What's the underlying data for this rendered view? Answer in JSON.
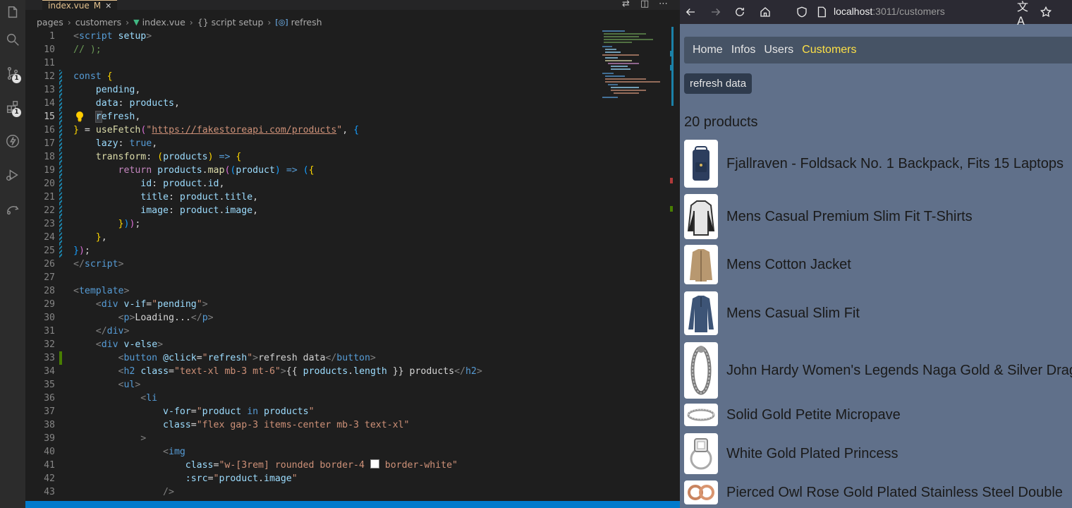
{
  "vscode": {
    "tab": {
      "filename": "index.vue",
      "modified": "M"
    },
    "breadcrumb": [
      "pages",
      "customers",
      "index.vue",
      "{} script setup",
      "refresh"
    ],
    "lines": [
      {
        "n": "1",
        "html": "<span class='pun'>&lt;</span><span class='tag'>script</span> <span class='attr'>setup</span><span class='pun'>&gt;</span>"
      },
      {
        "n": "10",
        "html": "<span class='cmt'>// );</span>"
      },
      {
        "n": "11",
        "html": ""
      },
      {
        "n": "12",
        "html": "<span class='kw'>const</span> <span class='br1'>{</span>"
      },
      {
        "n": "13",
        "html": "    <span class='var'>pending</span><span class='plain'>,</span>"
      },
      {
        "n": "14",
        "html": "    <span class='var'>data</span><span class='plain'>:</span> <span class='var'>products</span><span class='plain'>,</span>"
      },
      {
        "n": "15",
        "html": "    <span class='var hl'>r</span><span class='var'>efresh</span><span class='plain'>,</span>"
      },
      {
        "n": "16",
        "html": "<span class='br1'>}</span> <span class='plain'>=</span> <span class='fn'>useFetch</span><span class='br2'>(</span><span class='str'>\"</span><span class='url'>https://fakestoreapi.com/products</span><span class='str'>\"</span><span class='plain'>,</span> <span class='br3'>{</span>"
      },
      {
        "n": "17",
        "html": "    <span class='var'>lazy</span><span class='plain'>:</span> <span class='kw'>true</span><span class='plain'>,</span>"
      },
      {
        "n": "18",
        "html": "    <span class='fn'>transform</span><span class='plain'>:</span> <span class='br1'>(</span><span class='var'>products</span><span class='br1'>)</span> <span class='kw'>=&gt;</span> <span class='br1'>{</span>"
      },
      {
        "n": "19",
        "html": "        <span class='ctl'>return</span> <span class='var'>products</span><span class='plain'>.</span><span class='fn'>map</span><span class='br2'>(</span><span class='br3'>(</span><span class='var'>product</span><span class='br3'>)</span> <span class='kw'>=&gt;</span> <span class='br3'>(</span><span class='br1'>{</span>"
      },
      {
        "n": "20",
        "html": "            <span class='var'>id</span><span class='plain'>:</span> <span class='var'>product</span><span class='plain'>.</span><span class='var'>id</span><span class='plain'>,</span>"
      },
      {
        "n": "21",
        "html": "            <span class='var'>title</span><span class='plain'>:</span> <span class='var'>product</span><span class='plain'>.</span><span class='var'>title</span><span class='plain'>,</span>"
      },
      {
        "n": "22",
        "html": "            <span class='var'>image</span><span class='plain'>:</span> <span class='var'>product</span><span class='plain'>.</span><span class='var'>image</span><span class='plain'>,</span>"
      },
      {
        "n": "23",
        "html": "        <span class='br1'>}</span><span class='br3'>)</span><span class='br2'>)</span><span class='plain'>;</span>"
      },
      {
        "n": "24",
        "html": "    <span class='br1'>}</span><span class='plain'>,</span>"
      },
      {
        "n": "25",
        "html": "<span class='br3'>}</span><span class='br2'>)</span><span class='plain'>;</span>"
      },
      {
        "n": "26",
        "html": "<span class='pun'>&lt;/</span><span class='tag'>script</span><span class='pun'>&gt;</span>"
      },
      {
        "n": "27",
        "html": ""
      },
      {
        "n": "28",
        "html": "<span class='pun'>&lt;</span><span class='tag'>template</span><span class='pun'>&gt;</span>"
      },
      {
        "n": "29",
        "html": "    <span class='pun'>&lt;</span><span class='tag'>div</span> <span class='attr'>v-if</span><span class='plain'>=</span><span class='str'>\"</span><span class='var'>pending</span><span class='str'>\"</span><span class='pun'>&gt;</span>"
      },
      {
        "n": "30",
        "html": "        <span class='pun'>&lt;</span><span class='tag'>p</span><span class='pun'>&gt;</span><span class='plain'>Loading...</span><span class='pun'>&lt;/</span><span class='tag'>p</span><span class='pun'>&gt;</span>"
      },
      {
        "n": "31",
        "html": "    <span class='pun'>&lt;/</span><span class='tag'>div</span><span class='pun'>&gt;</span>"
      },
      {
        "n": "32",
        "html": "    <span class='pun'>&lt;</span><span class='tag'>div</span> <span class='attr'>v-else</span><span class='pun'>&gt;</span>"
      },
      {
        "n": "33",
        "html": "        <span class='pun'>&lt;</span><span class='tag'>button</span> <span class='attr'>@click</span><span class='plain'>=</span><span class='str'>\"</span><span class='var'>refresh</span><span class='str'>\"</span><span class='pun'>&gt;</span><span class='plain'>refresh data</span><span class='pun'>&lt;/</span><span class='tag'>button</span><span class='pun'>&gt;</span>"
      },
      {
        "n": "34",
        "html": "        <span class='pun'>&lt;</span><span class='tag'>h2</span> <span class='attr'>class</span><span class='plain'>=</span><span class='str'>\"text-xl mb-3 mt-6\"</span><span class='pun'>&gt;</span><span class='plain'>{{</span> <span class='var'>products</span><span class='plain'>.</span><span class='var'>length</span> <span class='plain'>}} products</span><span class='pun'>&lt;/</span><span class='tag'>h2</span><span class='pun'>&gt;</span>"
      },
      {
        "n": "35",
        "html": "        <span class='pun'>&lt;</span><span class='tag'>ul</span><span class='pun'>&gt;</span>"
      },
      {
        "n": "36",
        "html": "            <span class='pun'>&lt;</span><span class='tag'>li</span>"
      },
      {
        "n": "37",
        "html": "                <span class='attr'>v-for</span><span class='plain'>=</span><span class='str'>\"</span><span class='var'>product</span> <span class='kw'>in</span> <span class='var'>products</span><span class='str'>\"</span>"
      },
      {
        "n": "38",
        "html": "                <span class='attr'>class</span><span class='plain'>=</span><span class='str'>\"flex gap-3 items-center mb-3 text-xl\"</span>"
      },
      {
        "n": "39",
        "html": "            <span class='pun'>&gt;</span>"
      },
      {
        "n": "40",
        "html": "                <span class='pun'>&lt;</span><span class='tag'>img</span>"
      },
      {
        "n": "41",
        "html": "                    <span class='attr'>class</span><span class='plain'>=</span><span class='str'>\"w-[3rem] rounded border-4 <span style='display:inline-block;width:11px;height:11px;background:#fff;border:1px solid #888;vertical-align:-1px'></span> border-white\"</span>"
      },
      {
        "n": "42",
        "html": "                    <span class='attr'>:src</span><span class='plain'>=</span><span class='str'>\"</span><span class='var'>product</span><span class='plain'>.</span><span class='var'>image</span><span class='str'>\"</span>"
      },
      {
        "n": "43",
        "html": "                <span class='pun'>/&gt;</span>"
      }
    ]
  },
  "browser": {
    "url": {
      "host": "localhost",
      "rest": ":3011/customers"
    },
    "nav": [
      "Home",
      "Infos",
      "Users",
      "Customers"
    ],
    "active_nav": "Customers",
    "refresh_label": "refresh data",
    "count": "20 products",
    "products": [
      {
        "title": "Fjallraven - Foldsack No. 1 Backpack, Fits 15 Laptops",
        "icon": "backpack-icon"
      },
      {
        "title": "Mens Casual Premium Slim Fit T-Shirts",
        "icon": "tshirt-icon"
      },
      {
        "title": "Mens Cotton Jacket",
        "icon": "jacket-icon"
      },
      {
        "title": "Mens Casual Slim Fit",
        "icon": "longsleeve-icon"
      },
      {
        "title": "John Hardy Women's Legends Naga Gold & Silver Drag",
        "icon": "bracelet-icon"
      },
      {
        "title": "Solid Gold Petite Micropave",
        "icon": "ring-icon"
      },
      {
        "title": "White Gold Plated Princess",
        "icon": "diamond-ring-icon"
      },
      {
        "title": "Pierced Owl Rose Gold Plated Stainless Steel Double",
        "icon": "earrings-icon"
      }
    ]
  }
}
